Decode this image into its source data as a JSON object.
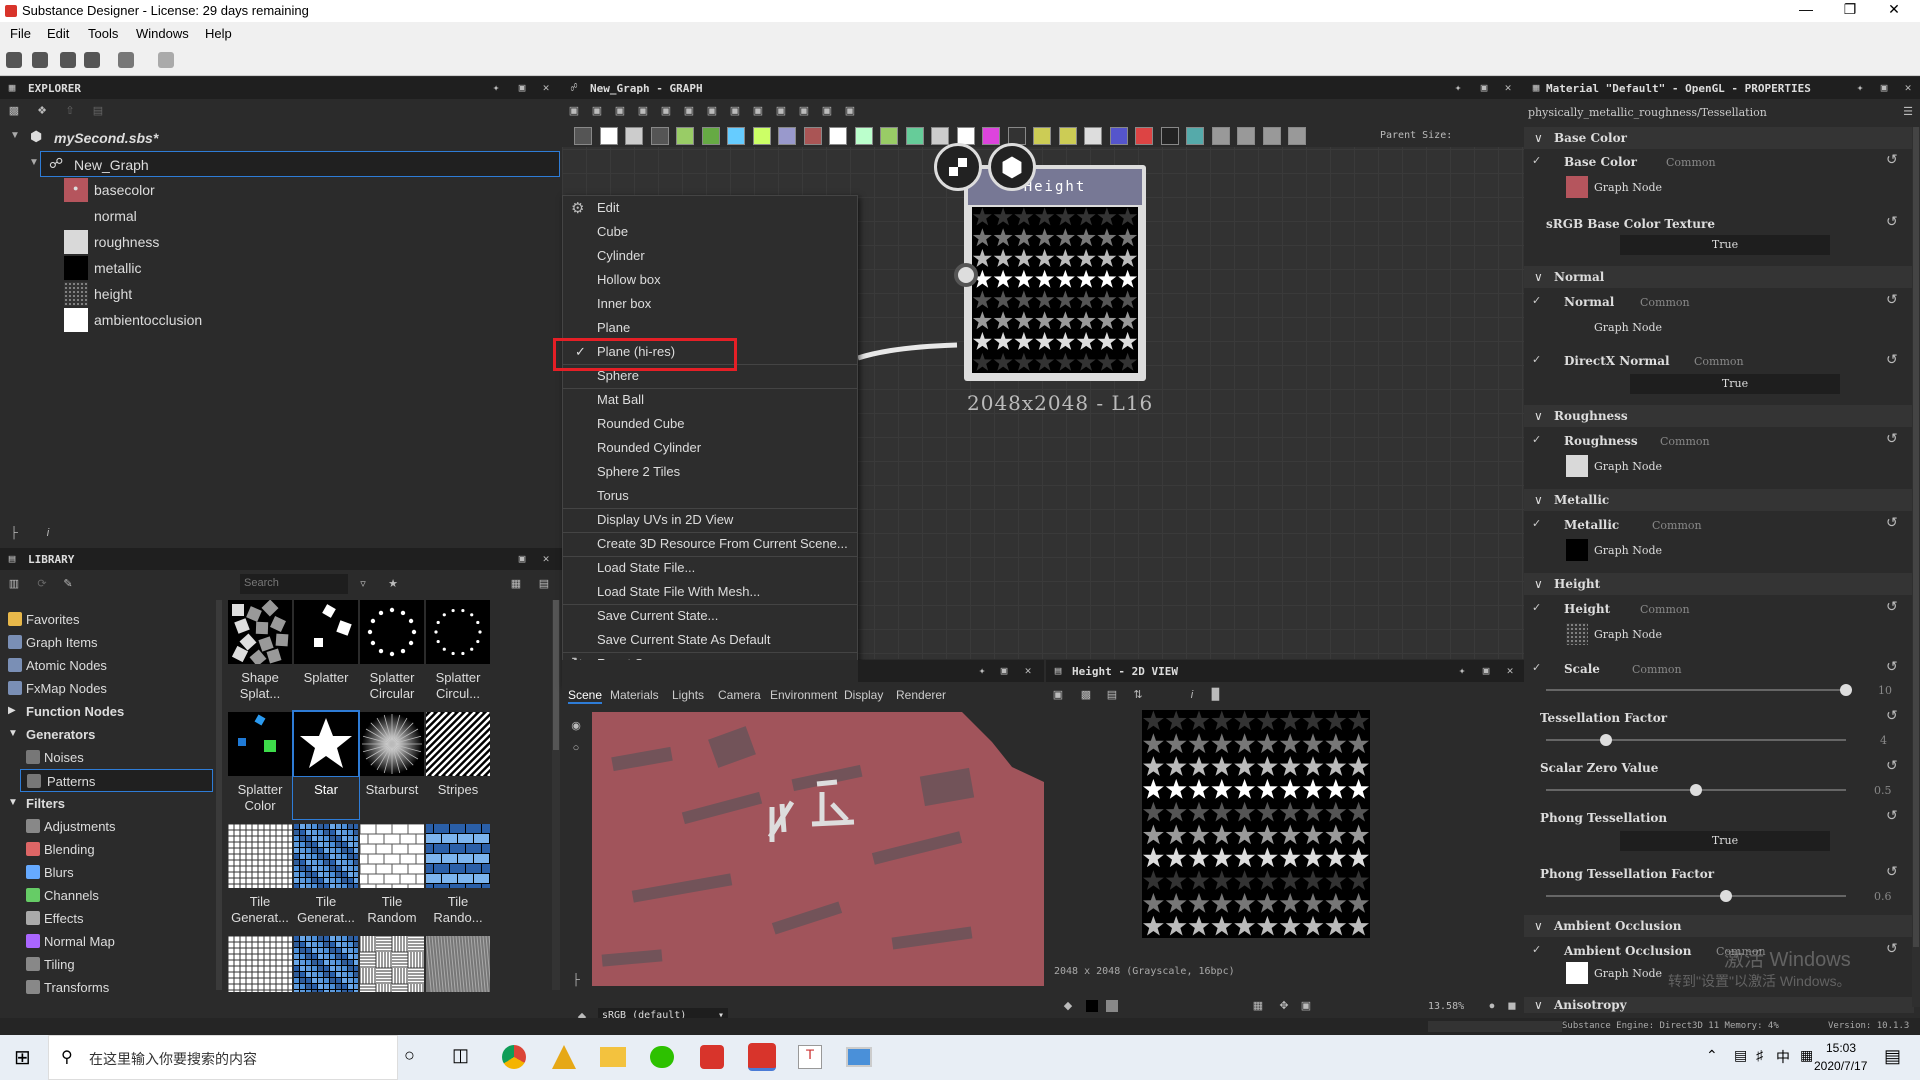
{
  "window": {
    "title": "Substance Designer - License: 29 days remaining"
  },
  "menu": [
    "File",
    "Edit",
    "Tools",
    "Windows",
    "Help"
  ],
  "explorer": {
    "title": "EXPLORER",
    "package": "mySecond.sbs*",
    "graph": "New_Graph",
    "outputs": [
      {
        "label": "basecolor",
        "color": "#b5555d"
      },
      {
        "label": "normal",
        "color": ""
      },
      {
        "label": "roughness",
        "color": "#d9d9d9"
      },
      {
        "label": "metallic",
        "color": "#000000"
      },
      {
        "label": "height",
        "color": "#333333"
      },
      {
        "label": "ambientocclusion",
        "color": "#ffffff"
      }
    ]
  },
  "library": {
    "title": "LIBRARY",
    "search_placeholder": "Search",
    "categories": [
      {
        "label": "Favorites",
        "color": "#e8b84a",
        "bold": false
      },
      {
        "label": "Graph Items",
        "color": "#7a8fb5",
        "bold": false
      },
      {
        "label": "Atomic Nodes",
        "color": "#7a8fb5",
        "bold": false
      },
      {
        "label": "FxMap Nodes",
        "color": "#7a8fb5",
        "bold": false
      },
      {
        "label": "Function Nodes",
        "color": "",
        "bold": true
      },
      {
        "label": "Generators",
        "color": "",
        "bold": true
      },
      {
        "label": "Noises",
        "color": "#777",
        "bold": false
      },
      {
        "label": "Patterns",
        "color": "#777",
        "bold": false
      },
      {
        "label": "Filters",
        "color": "",
        "bold": true
      },
      {
        "label": "Adjustments",
        "color": "#888",
        "bold": false
      },
      {
        "label": "Blending",
        "color": "#d66",
        "bold": false
      },
      {
        "label": "Blurs",
        "color": "#6af",
        "bold": false
      },
      {
        "label": "Channels",
        "color": "#6c6",
        "bold": false
      },
      {
        "label": "Effects",
        "color": "#aaa",
        "bold": false
      },
      {
        "label": "Normal Map",
        "color": "#a6f",
        "bold": false
      },
      {
        "label": "Tiling",
        "color": "#888",
        "bold": false
      },
      {
        "label": "Transforms",
        "color": "#888",
        "bold": false
      }
    ],
    "items": [
      {
        "label": "Shape Splat...",
        "kind": "shapes"
      },
      {
        "label": "Splatter",
        "kind": "splatter"
      },
      {
        "label": "Splatter Circular",
        "kind": "circle"
      },
      {
        "label": "Splatter Circul...",
        "kind": "circle2"
      },
      {
        "label": "Splatter Color",
        "kind": "color"
      },
      {
        "label": "Star",
        "kind": "star"
      },
      {
        "label": "Starburst",
        "kind": "burst"
      },
      {
        "label": "Stripes",
        "kind": "stripes"
      },
      {
        "label": "Tile Generat...",
        "kind": "grid"
      },
      {
        "label": "Tile Generat...",
        "kind": "bluegrid"
      },
      {
        "label": "Tile Random",
        "kind": "bricks"
      },
      {
        "label": "Tile Rando...",
        "kind": "bluebricks"
      },
      {
        "label": "",
        "kind": "grid"
      },
      {
        "label": "",
        "kind": "bluegrid"
      },
      {
        "label": "",
        "kind": "weave"
      },
      {
        "label": "",
        "kind": "noise"
      }
    ]
  },
  "graph": {
    "title": "New_Graph - GRAPH",
    "parent_size_label": "Parent Size:",
    "node": {
      "title": "Height",
      "size_label": "2048x2048 - L16"
    }
  },
  "context_menu": {
    "header": "Edit",
    "items": [
      "Cube",
      "Cylinder",
      "Hollow box",
      "Inner box",
      "Plane",
      "Plane (hi-res)",
      "Sphere",
      "Mat Ball",
      "Rounded Cube",
      "Rounded Cylinder",
      "Sphere 2 Tiles",
      "Torus",
      "Display UVs in 2D View",
      "Create 3D Resource From Current Scene...",
      "Load State File...",
      "Load State File With Mesh...",
      "Save Current State...",
      "Save Current State As Default",
      "Reset Scene"
    ],
    "checked": "Plane (hi-res)"
  },
  "scene": {
    "tabs": [
      "Scene",
      "Materials",
      "Lights",
      "Camera",
      "Environment",
      "Display",
      "Renderer"
    ],
    "colorspace": "sRGB (default)"
  },
  "view2d": {
    "title": "Height - 2D VIEW",
    "info": "2048 x 2048 (Grayscale, 16bpc)",
    "zoom": "13.58%"
  },
  "properties": {
    "title": "Material \"Default\" - OpenGL - PROPERTIES",
    "path": "physically_metallic_roughness/Tessellation",
    "common": "Common",
    "graph_node": "Graph Node",
    "true_label": "True",
    "sections": {
      "base_color": "Base Color",
      "srgb": "sRGB Base Color Texture",
      "normal": "Normal",
      "directx": "DirectX Normal",
      "roughness": "Roughness",
      "metallic": "Metallic",
      "height": "Height",
      "scale": "Scale",
      "tess": "Tessellation Factor",
      "scalar_zero": "Scalar Zero Value",
      "phong": "Phong Tessellation",
      "phong_factor": "Phong Tessellation Factor",
      "ao": "Ambient Occlusion",
      "aniso": "Anisotropy"
    },
    "values": {
      "scale": "10",
      "tess": "4",
      "scalar_zero": "0.5",
      "phong_factor": "0.6"
    },
    "levels": {
      "scale": 1.0,
      "tess": 0.2,
      "scalar_zero": 0.5,
      "phong_factor": 0.6
    }
  },
  "status": {
    "engine": "Substance Engine: Direct3D 11  Memory: 4%",
    "version": "Version: 10.1.3"
  },
  "watermark": {
    "line1": "激活 Windows",
    "line2": "转到\"设置\"以激活 Windows。"
  },
  "taskbar": {
    "search": "在这里输入你要搜索的内容",
    "time": "15:03",
    "date": "2020/7/17",
    "ime": "中"
  }
}
